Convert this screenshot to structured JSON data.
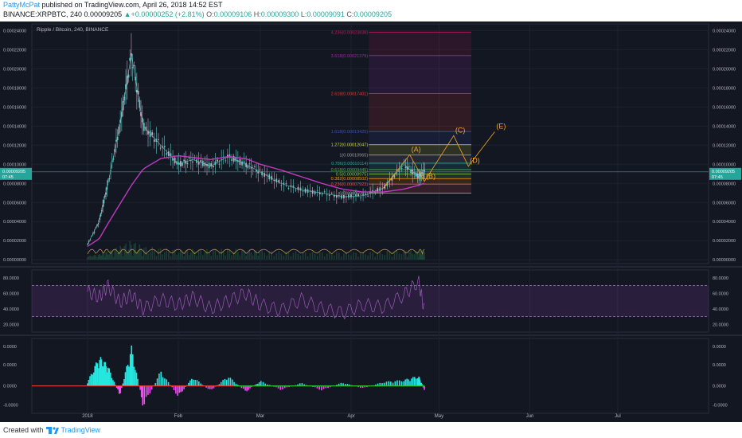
{
  "header": {
    "author": "PattyMcPat",
    "published": "published on TradingView.com, April 26, 2018 14:52 EST",
    "symbol_line": "BINANCE:XRPBTC, 240",
    "last": "0.00009205",
    "change": "+0.00000252 (+2.81%)",
    "o_label": "O:",
    "o": "0.00009106",
    "h_label": "H:",
    "h": "0.00009300",
    "l_label": "L:",
    "l": "0.00009091",
    "c_label": "C:",
    "c": "0.00009205"
  },
  "footer": {
    "created_with": "Created with",
    "brand": "TradingView"
  },
  "colors": {
    "background": "#131722",
    "candle_up": "#5ec8c4",
    "candle_down": "#d0a8c0",
    "ma": "#c03ac0",
    "rsi": "#7b3fa0",
    "osc_up": "#26e6e0",
    "osc_down": "#ff44ff",
    "price_line": "#26a69a",
    "wave_label": "#f5a623"
  },
  "chart_data": [
    {
      "type": "line",
      "title": "Ripple / Bitcoin, 240, BINANCE",
      "x": [
        "2018-01-01",
        "2018-01-05",
        "2018-01-08",
        "2018-01-12",
        "2018-01-16",
        "2018-01-20",
        "2018-01-26",
        "2018-02-01",
        "2018-02-06",
        "2018-02-12",
        "2018-02-18",
        "2018-02-24",
        "2018-03-01",
        "2018-03-08",
        "2018-03-15",
        "2018-03-22",
        "2018-03-29",
        "2018-04-05",
        "2018-04-12",
        "2018-04-19",
        "2018-04-24",
        "2018-04-26"
      ],
      "series": [
        {
          "values": [
            1.6e-05,
            4e-05,
            8e-05,
            0.00014,
            0.000215,
            0.00014,
            0.00012,
            0.0001,
            0.000105,
            9.8e-05,
            0.000108,
            0.0001,
            9.2e-05,
            8e-05,
            7.3e-05,
            7e-05,
            6.6e-05,
            6.7e-05,
            7.5e-05,
            0.0001,
            8.7e-05,
            9.2e-05
          ]
        },
        {
          "values": [
            1.4e-05,
            2.2e-05,
            3.8e-05,
            5.8e-05,
            7.8e-05,
            9.5e-05,
            0.000106,
            0.000109,
            0.000107,
            0.000105,
            0.000108,
            0.000106,
            0.0001,
            9.4e-05,
            8.7e-05,
            8e-05,
            7.4e-05,
            7.1e-05,
            7.1e-05,
            7.4e-05,
            7.8e-05,
            8e-05
          ]
        }
      ],
      "ylim": [
        -4e-06,
        0.000247
      ],
      "y_ticks": [
        "0.00024000",
        "0.00022000",
        "0.00020000",
        "0.00018000",
        "0.00016000",
        "0.00014000",
        "0.00012000",
        "0.00010000",
        "0.00008000",
        "0.00006000",
        "0.00004000",
        "0.00002000",
        "0.00000000"
      ],
      "y_tick_values": [
        0.00024,
        0.00022,
        0.0002,
        0.00018,
        0.00016,
        0.00014,
        0.00012,
        0.0001,
        8e-05,
        6e-05,
        4e-05,
        2e-05,
        0
      ],
      "x_ticks": [
        "2018",
        "Feb",
        "Mar",
        "Apr",
        "May",
        "Jun",
        "Jul"
      ],
      "x_tick_dates": [
        "2018-01-01",
        "2018-02-01",
        "2018-03-01",
        "2018-04-01",
        "2018-05-01",
        "2018-06-01",
        "2018-07-01"
      ],
      "last_price_label": "0.00009205",
      "countdown_label": "07:45",
      "fibonacci": [
        {
          "label": "4.236(0.00023838)",
          "value": 0.00023838,
          "color": "#c2185b"
        },
        {
          "label": "3.618(0.00021379)",
          "value": 0.00021379,
          "color": "#9c27b0"
        },
        {
          "label": "2.618(0.00017401)",
          "value": 0.00017401,
          "color": "#e53935"
        },
        {
          "label": "1.618(0.00013425)",
          "value": 0.00013425,
          "color": "#3f51b5"
        },
        {
          "label": "1.272(0.00012047)",
          "value": 0.00012047,
          "color": "#cddc39"
        },
        {
          "label": "1(0.00010965)",
          "value": 0.00010965,
          "color": "#9e9e9e"
        },
        {
          "label": "0.786(0.00010114)",
          "value": 0.00010114,
          "color": "#26a69a"
        },
        {
          "label": "0.618(0.00009445)",
          "value": 9.445e-05,
          "color": "#4caf50"
        },
        {
          "label": "0.5(0.00008975)",
          "value": 8.975e-05,
          "color": "#8bc34a"
        },
        {
          "label": "0.382(0.00008502)",
          "value": 8.502e-05,
          "color": "#ff9800"
        },
        {
          "label": "0.236(0.00007923)",
          "value": 7.923e-05,
          "color": "#ef5350"
        },
        {
          "label": "0(0.00006987)",
          "value": 6.987e-05,
          "color": "#9e9e9e"
        }
      ],
      "waves": [
        {
          "label": "(A)",
          "x": "2018-04-21",
          "y": 0.00011
        },
        {
          "label": "(B)",
          "x": "2018-04-26",
          "y": 8.2e-05
        },
        {
          "label": "(C)",
          "x": "2018-05-06",
          "y": 0.00013
        },
        {
          "label": "(D)",
          "x": "2018-05-11",
          "y": 9.8e-05
        },
        {
          "label": "(E)",
          "x": "2018-05-20",
          "y": 0.000134
        }
      ]
    },
    {
      "type": "line",
      "series": [
        {
          "values": [
            62,
            55,
            70,
            48,
            58,
            40,
            52,
            45,
            55,
            40,
            50,
            60,
            45,
            38,
            52,
            40,
            35,
            45,
            42,
            58,
            75,
            38
          ]
        }
      ],
      "ylim": [
        10,
        90
      ],
      "y_ticks": [
        "80.0000",
        "60.0000",
        "40.0000",
        "20.0000"
      ],
      "y_tick_values": [
        80,
        60,
        40,
        20
      ],
      "levels": [
        70,
        30
      ]
    },
    {
      "type": "bar",
      "series": [
        {
          "values": [
            8e-07,
            5.8e-06,
            4e-06,
            -2e-06,
            7.8e-06,
            -4.2e-06,
            3e-06,
            -2.2e-06,
            1.8e-06,
            -1e-06,
            2e-06,
            -1.2e-06,
            1e-06,
            -8e-07,
            6e-07,
            -9e-07,
            7e-07,
            -5e-07,
            8e-07,
            1.2e-06,
            2e-06,
            -8e-07
          ]
        }
      ],
      "ylim": [
        -5.2e-06,
        9e-06
      ],
      "y_ticks": [
        "0.0000",
        "0.0000",
        "0.0000",
        "-0.0000",
        "-0.0000"
      ],
      "y_tick_values": [
        7.5e-06,
        4e-06,
        0,
        -3.6e-06,
        -7.2e-06
      ]
    }
  ]
}
